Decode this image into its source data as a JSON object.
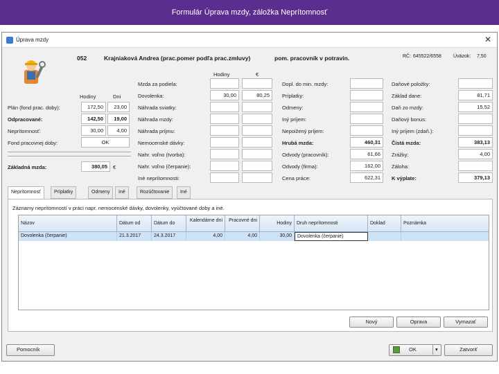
{
  "slide": {
    "title": "Formulár Úprava mzdy, záložka Neprítomnosť"
  },
  "window": {
    "title": "Úprava mzdy",
    "close": "✕"
  },
  "employee": {
    "id": "052",
    "name": "Krajniaková Andrea (prac.pomer podľa prac.zmluvy)",
    "position": "pom. pracovník v potravin.",
    "rc_label": "RČ:",
    "rc_value": "645522/6558",
    "uvazok_label": "Úväzok:",
    "uvazok_value": "7,50"
  },
  "left": {
    "col_hodiny": "Hodiny",
    "col_dni": "Dni",
    "rows": [
      {
        "label": "Plán (fond prac. doby):",
        "hours": "172,50",
        "days": "23,00",
        "bold": false
      },
      {
        "label": "Odpracované:",
        "hours": "142,50",
        "days": "19,00",
        "bold": true
      },
      {
        "label": "Neprítomnosť:",
        "hours": "30,00",
        "days": "4,00",
        "bold": false
      }
    ],
    "fond_label": "Fond pracovnej doby:",
    "fond_value": "OK",
    "zakladna_label": "Základná mzda:",
    "zakladna_value": "380,05",
    "zakladna_unit": "€"
  },
  "mid": {
    "col_hodiny": "Hodiny",
    "col_euro": "€",
    "rows": [
      {
        "label": "Mzda za podiela:",
        "h": "",
        "e": ""
      },
      {
        "label": "Dovolenka:",
        "h": "30,00",
        "e": "80,25"
      },
      {
        "label": "Náhrada sviatky:",
        "h": "",
        "e": ""
      },
      {
        "label": "Náhrada mzdy:",
        "h": "",
        "e": ""
      },
      {
        "label": "Náhrada príjmu:",
        "h": "",
        "e": ""
      },
      {
        "label": "Nemocenské dávky:",
        "h": "",
        "e": ""
      },
      {
        "label": "Nahr. voľno (tvorba):",
        "h": "",
        "e": ""
      },
      {
        "label": "Nahr. voľno (čerpanie):",
        "h": "",
        "e": ""
      },
      {
        "label": "Iné neprítomnosti:",
        "h": "",
        "e": ""
      }
    ]
  },
  "right1": {
    "rows": [
      {
        "label": "Dopl. do min. mzdy:",
        "v": "",
        "bold": false
      },
      {
        "label": "Príplatky:",
        "v": "",
        "bold": false
      },
      {
        "label": "Odmeny:",
        "v": "",
        "bold": false
      },
      {
        "label": "Iný príjem:",
        "v": "",
        "bold": false
      },
      {
        "label": "Nepoižený príjem:",
        "v": "",
        "bold": false
      },
      {
        "label": "Hrubá mzda:",
        "v": "460,31",
        "bold": true
      },
      {
        "label": "Odvody (pracovník):",
        "v": "61,66",
        "bold": false
      },
      {
        "label": "Odvody (firma):",
        "v": "162,00",
        "bold": false
      },
      {
        "label": "Cena práce:",
        "v": "622,31",
        "bold": false
      }
    ]
  },
  "right2": {
    "rows": [
      {
        "label": "Daňové položky:",
        "v": "",
        "bold": false
      },
      {
        "label": "Základ dane:",
        "v": "81,71",
        "bold": false
      },
      {
        "label": "Daň zo mzdy:",
        "v": "15,52",
        "bold": false
      },
      {
        "label": "Daňový bonus:",
        "v": "",
        "bold": false
      },
      {
        "label": "Iný príjem (zdaň.):",
        "v": "",
        "bold": false
      },
      {
        "label": "Čistá mzda:",
        "v": "383,13",
        "bold": true
      },
      {
        "label": "Zrážky:",
        "v": "4,00",
        "bold": false
      },
      {
        "label": "Záloha:",
        "v": "",
        "bold": false
      },
      {
        "label": "K výplate:",
        "v": "379,13",
        "bold": true
      }
    ]
  },
  "tabs": [
    "Neprítomnosť",
    "Príplatky",
    "Odmeny",
    "Iné",
    "Rozúčtovanie",
    "Iné"
  ],
  "panel": {
    "caption": "Záznamy neprítomností v práci napr. nemocenské dávky, dovolenky, vyúčtované doby a iné.",
    "columns": [
      "Názov",
      "Dátum od",
      "Dátum do",
      "Kalendárne dni",
      "Pracovné dni",
      "Hodiny",
      "Druh neprítomnosti",
      "Doklad",
      "Poznámka"
    ],
    "rows": [
      [
        "Dovolenka (čerpanie)",
        "21.3.2017",
        "24.3.2017",
        "4,00",
        "4,00",
        "30,00",
        "Dovolenka (čerpanie)",
        "",
        ""
      ]
    ],
    "buttons": {
      "new": "Nový",
      "edit": "Oprava",
      "delete": "Vymazať"
    }
  },
  "footer": {
    "helper": "Pomocník",
    "ok": "OK",
    "close": "Zatvoriť"
  },
  "colors": {
    "slide_bar": "#5b2d8e",
    "row_selected": "#cfe3f7"
  },
  "icons": [
    "worker-icon",
    "close-icon",
    "printer-icon",
    "dropdown-arrow-icon"
  ]
}
